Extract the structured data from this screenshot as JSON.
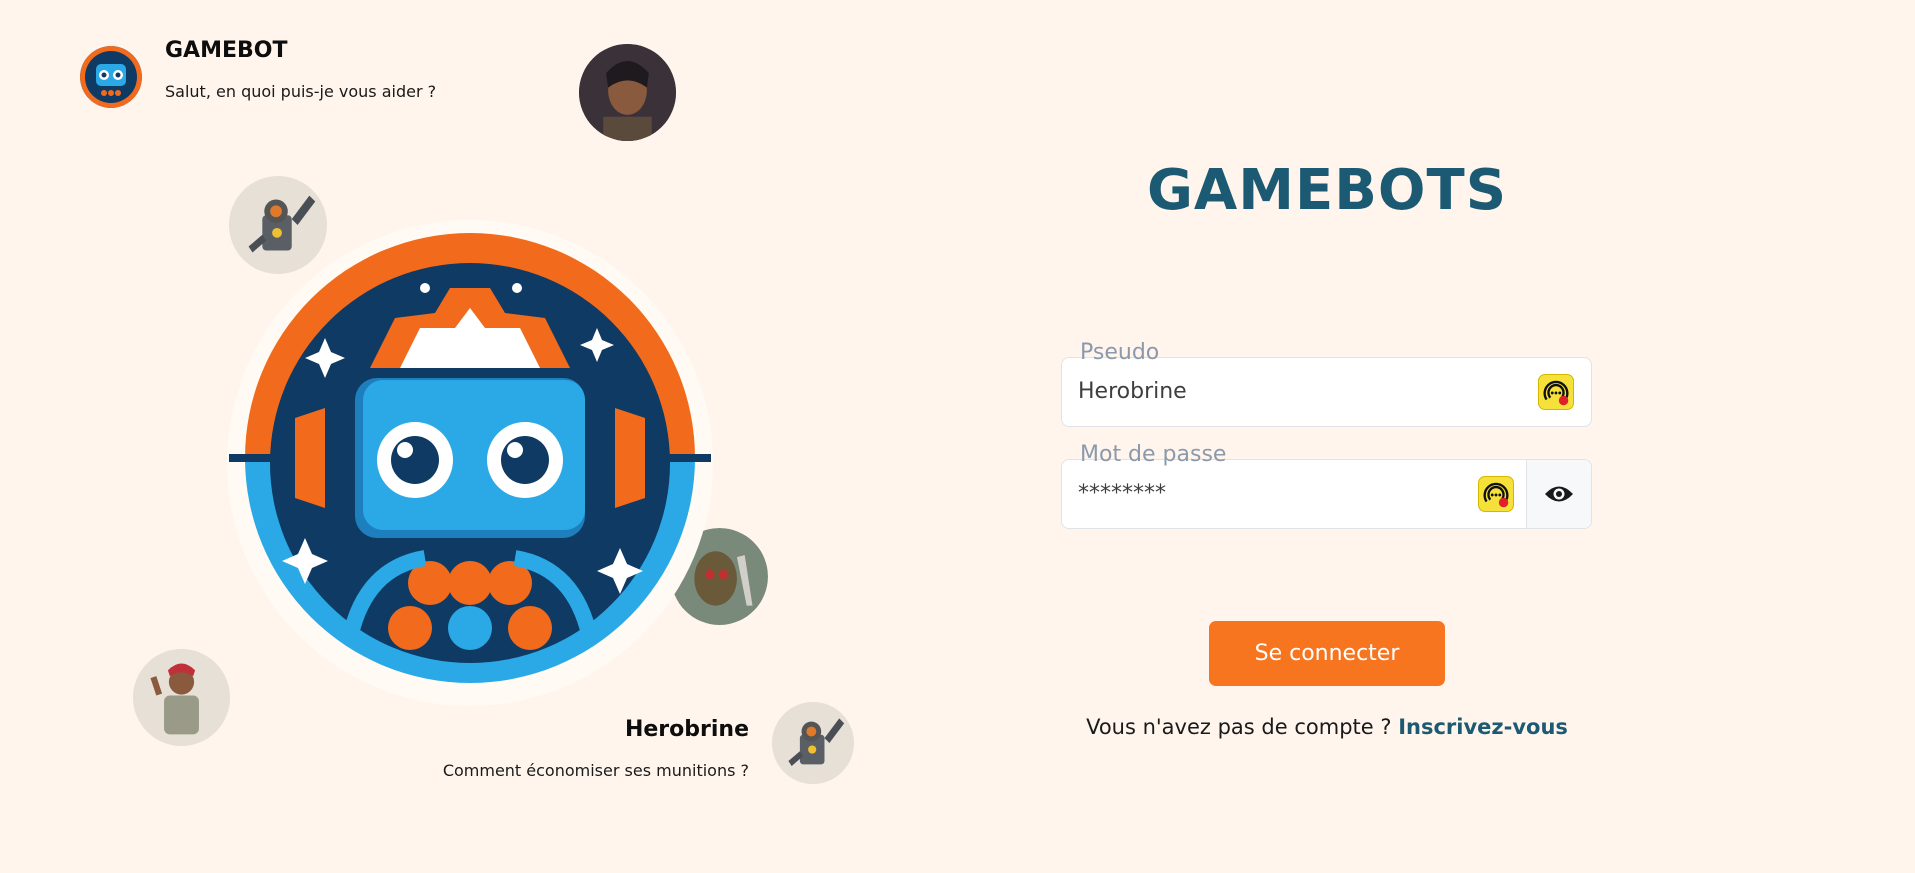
{
  "chat_top": {
    "name": "GAMEBOT",
    "message": "Salut, en quoi puis-je vous aider ?"
  },
  "chat_bottom": {
    "name": "Herobrine",
    "message": "Comment économiser ses munitions ?"
  },
  "brand": {
    "title": "GAMEBOTS"
  },
  "form": {
    "pseudo": {
      "label": "Pseudo",
      "value": "Herobrine"
    },
    "password": {
      "label": "Mot de passe",
      "value": "********"
    },
    "submit_label": "Se connecter"
  },
  "signup": {
    "prompt": "Vous n'avez pas de compte ?",
    "link_label": "Inscrivez-vous"
  },
  "colors": {
    "background": "#fff5ec",
    "brand": "#1b5a72",
    "accent": "#f7751f",
    "badge": "#f5e13a"
  },
  "icons": {
    "password_badge": "password-manager-icon",
    "toggle_visibility": "eye-icon"
  }
}
